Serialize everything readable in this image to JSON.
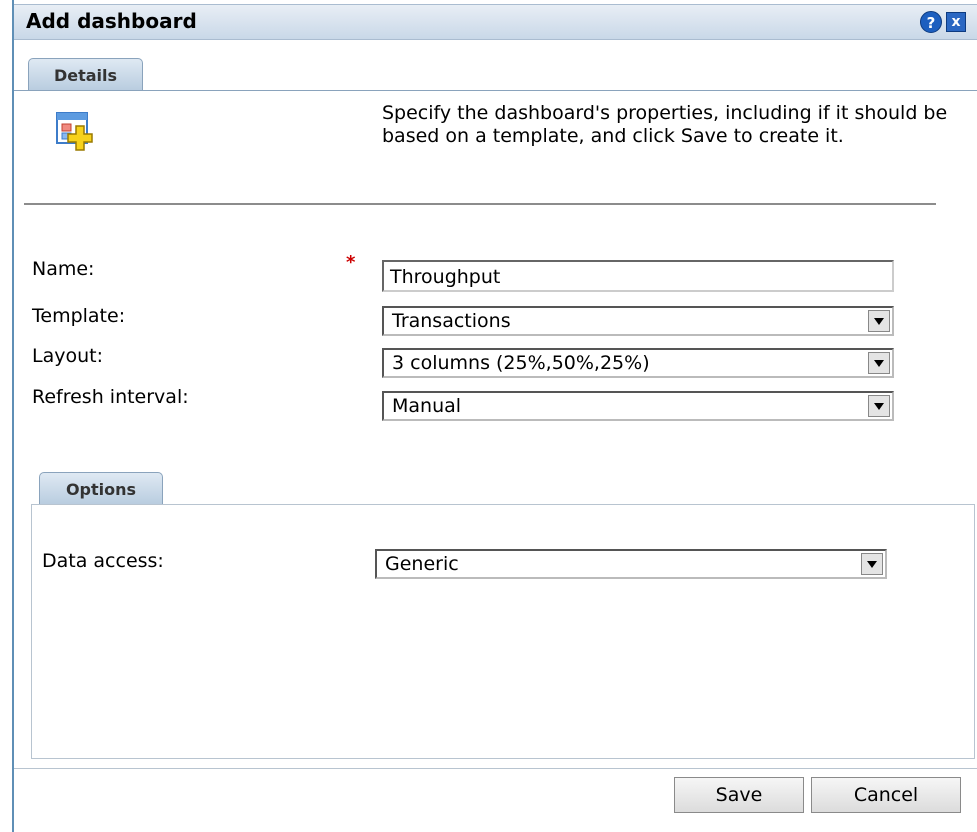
{
  "dialog": {
    "title": "Add dashboard",
    "help_icon_glyph": "?",
    "close_icon_glyph": "x"
  },
  "tabs": {
    "details_label": "Details",
    "options_label": "Options"
  },
  "intro": {
    "icon": "add-dashboard-icon",
    "text": "Specify the dashboard's properties, including if it should be based on a template, and click Save to create it."
  },
  "form": {
    "required_mark": "*",
    "name_label": "Name:",
    "name_value": "Throughput",
    "template_label": "Template:",
    "template_value": "Transactions",
    "layout_label": "Layout:",
    "layout_value": "3 columns (25%,50%,25%)",
    "refresh_label": "Refresh interval:",
    "refresh_value": "Manual"
  },
  "options": {
    "data_access_label": "Data access:",
    "data_access_value": "Generic"
  },
  "buttons": {
    "save": "Save",
    "cancel": "Cancel"
  },
  "colors": {
    "titlebar": "#c9d8e8",
    "required": "#cc0000",
    "tab": "#b8ccdf"
  }
}
